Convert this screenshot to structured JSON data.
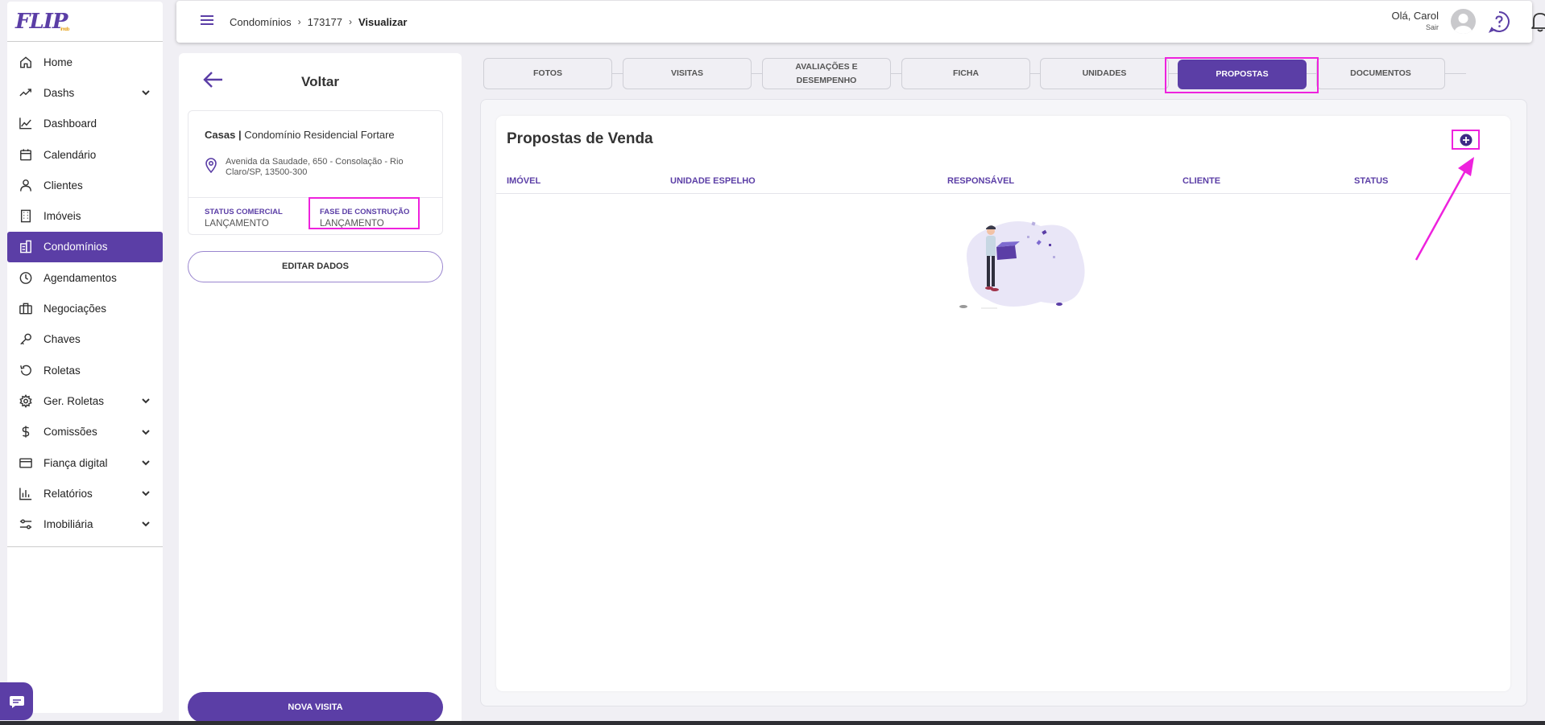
{
  "brand": {
    "logo_text": "FLIP",
    "logo_sub": "imob"
  },
  "sidebar": {
    "items": [
      {
        "label": "Home",
        "icon": "home-icon",
        "active": false,
        "expandable": false
      },
      {
        "label": "Dashs",
        "icon": "trend-icon",
        "active": false,
        "expandable": true
      },
      {
        "label": "Dashboard",
        "icon": "chart-line-icon",
        "active": false,
        "expandable": false
      },
      {
        "label": "Calendário",
        "icon": "calendar-icon",
        "active": false,
        "expandable": false
      },
      {
        "label": "Clientes",
        "icon": "person-icon",
        "active": false,
        "expandable": false
      },
      {
        "label": "Imóveis",
        "icon": "building-icon",
        "active": false,
        "expandable": false
      },
      {
        "label": "Condomínios",
        "icon": "buildings-icon",
        "active": true,
        "expandable": false
      },
      {
        "label": "Agendamentos",
        "icon": "clock-icon",
        "active": false,
        "expandable": false
      },
      {
        "label": "Negociações",
        "icon": "briefcase-icon",
        "active": false,
        "expandable": false
      },
      {
        "label": "Chaves",
        "icon": "key-icon",
        "active": false,
        "expandable": false
      },
      {
        "label": "Roletas",
        "icon": "rotate-icon",
        "active": false,
        "expandable": false
      },
      {
        "label": "Ger. Roletas",
        "icon": "gear-icon",
        "active": false,
        "expandable": true
      },
      {
        "label": "Comissões",
        "icon": "dollar-icon",
        "active": false,
        "expandable": true
      },
      {
        "label": "Fiança digital",
        "icon": "card-icon",
        "active": false,
        "expandable": true
      },
      {
        "label": "Relatórios",
        "icon": "bar-chart-icon",
        "active": false,
        "expandable": true
      },
      {
        "label": "Imobiliária",
        "icon": "sliders-icon",
        "active": false,
        "expandable": true
      }
    ]
  },
  "header": {
    "breadcrumb": [
      "Condomínios",
      "173177",
      "Visualizar"
    ],
    "greeting": "Olá, Carol",
    "logout": "Sair"
  },
  "property": {
    "back_label": "Voltar",
    "type": "Casas",
    "separator": "|",
    "name": "Condomínio Residencial Fortare",
    "address": "Avenida da Saudade, 650 - Consolação - Rio Claro/SP, 13500-300",
    "status_comercial_label": "STATUS COMERCIAL",
    "status_comercial_value": "LANÇAMENTO",
    "fase_label": "FASE DE CONSTRUÇÃO",
    "fase_value": "LANÇAMENTO",
    "edit_button": "EDITAR DADOS",
    "new_visit_button": "NOVA VISITA"
  },
  "tabs": [
    {
      "label": "FOTOS",
      "active": false
    },
    {
      "label": "VISITAS",
      "active": false
    },
    {
      "label": "AVALIAÇÕES E DESEMPENHO",
      "active": false
    },
    {
      "label": "FICHA",
      "active": false
    },
    {
      "label": "UNIDADES",
      "active": false
    },
    {
      "label": "PROPOSTAS",
      "active": true
    },
    {
      "label": "DOCUMENTOS",
      "active": false
    }
  ],
  "proposals": {
    "title": "Propostas de Venda",
    "columns": [
      "IMÓVEL",
      "UNIDADE ESPELHO",
      "RESPONSÁVEL",
      "CLIENTE",
      "STATUS"
    ],
    "rows": []
  },
  "colors": {
    "primary": "#5b3ea6",
    "highlight": "#ee22dd",
    "accent_logo": "#e5a21b"
  }
}
